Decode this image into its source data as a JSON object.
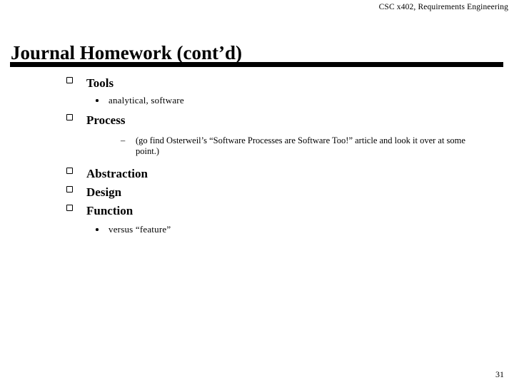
{
  "slide": {
    "header": "CSC x402, Requirements Engineering",
    "title": "Journal Homework (cont’d)",
    "page_number": "31",
    "background_color": "#ffffff",
    "text_color": "#000000",
    "rule_color": "#000000",
    "bullets": {
      "level1_glyph": "box-outline",
      "level2_glyph": "•",
      "level3_glyph": "–"
    },
    "content": [
      {
        "level": 1,
        "text": "Tools"
      },
      {
        "level": 2,
        "text": "analytical, software"
      },
      {
        "level": 1,
        "text": "Process"
      },
      {
        "level": 3,
        "text": "(go find Osterweil’s “Software Processes are Software Too!” article and look it over at some point.)"
      },
      {
        "level": 1,
        "text": "Abstraction"
      },
      {
        "level": 1,
        "text": "Design"
      },
      {
        "level": 1,
        "text": "Function"
      },
      {
        "level": 2,
        "text": "versus “feature”"
      }
    ]
  }
}
